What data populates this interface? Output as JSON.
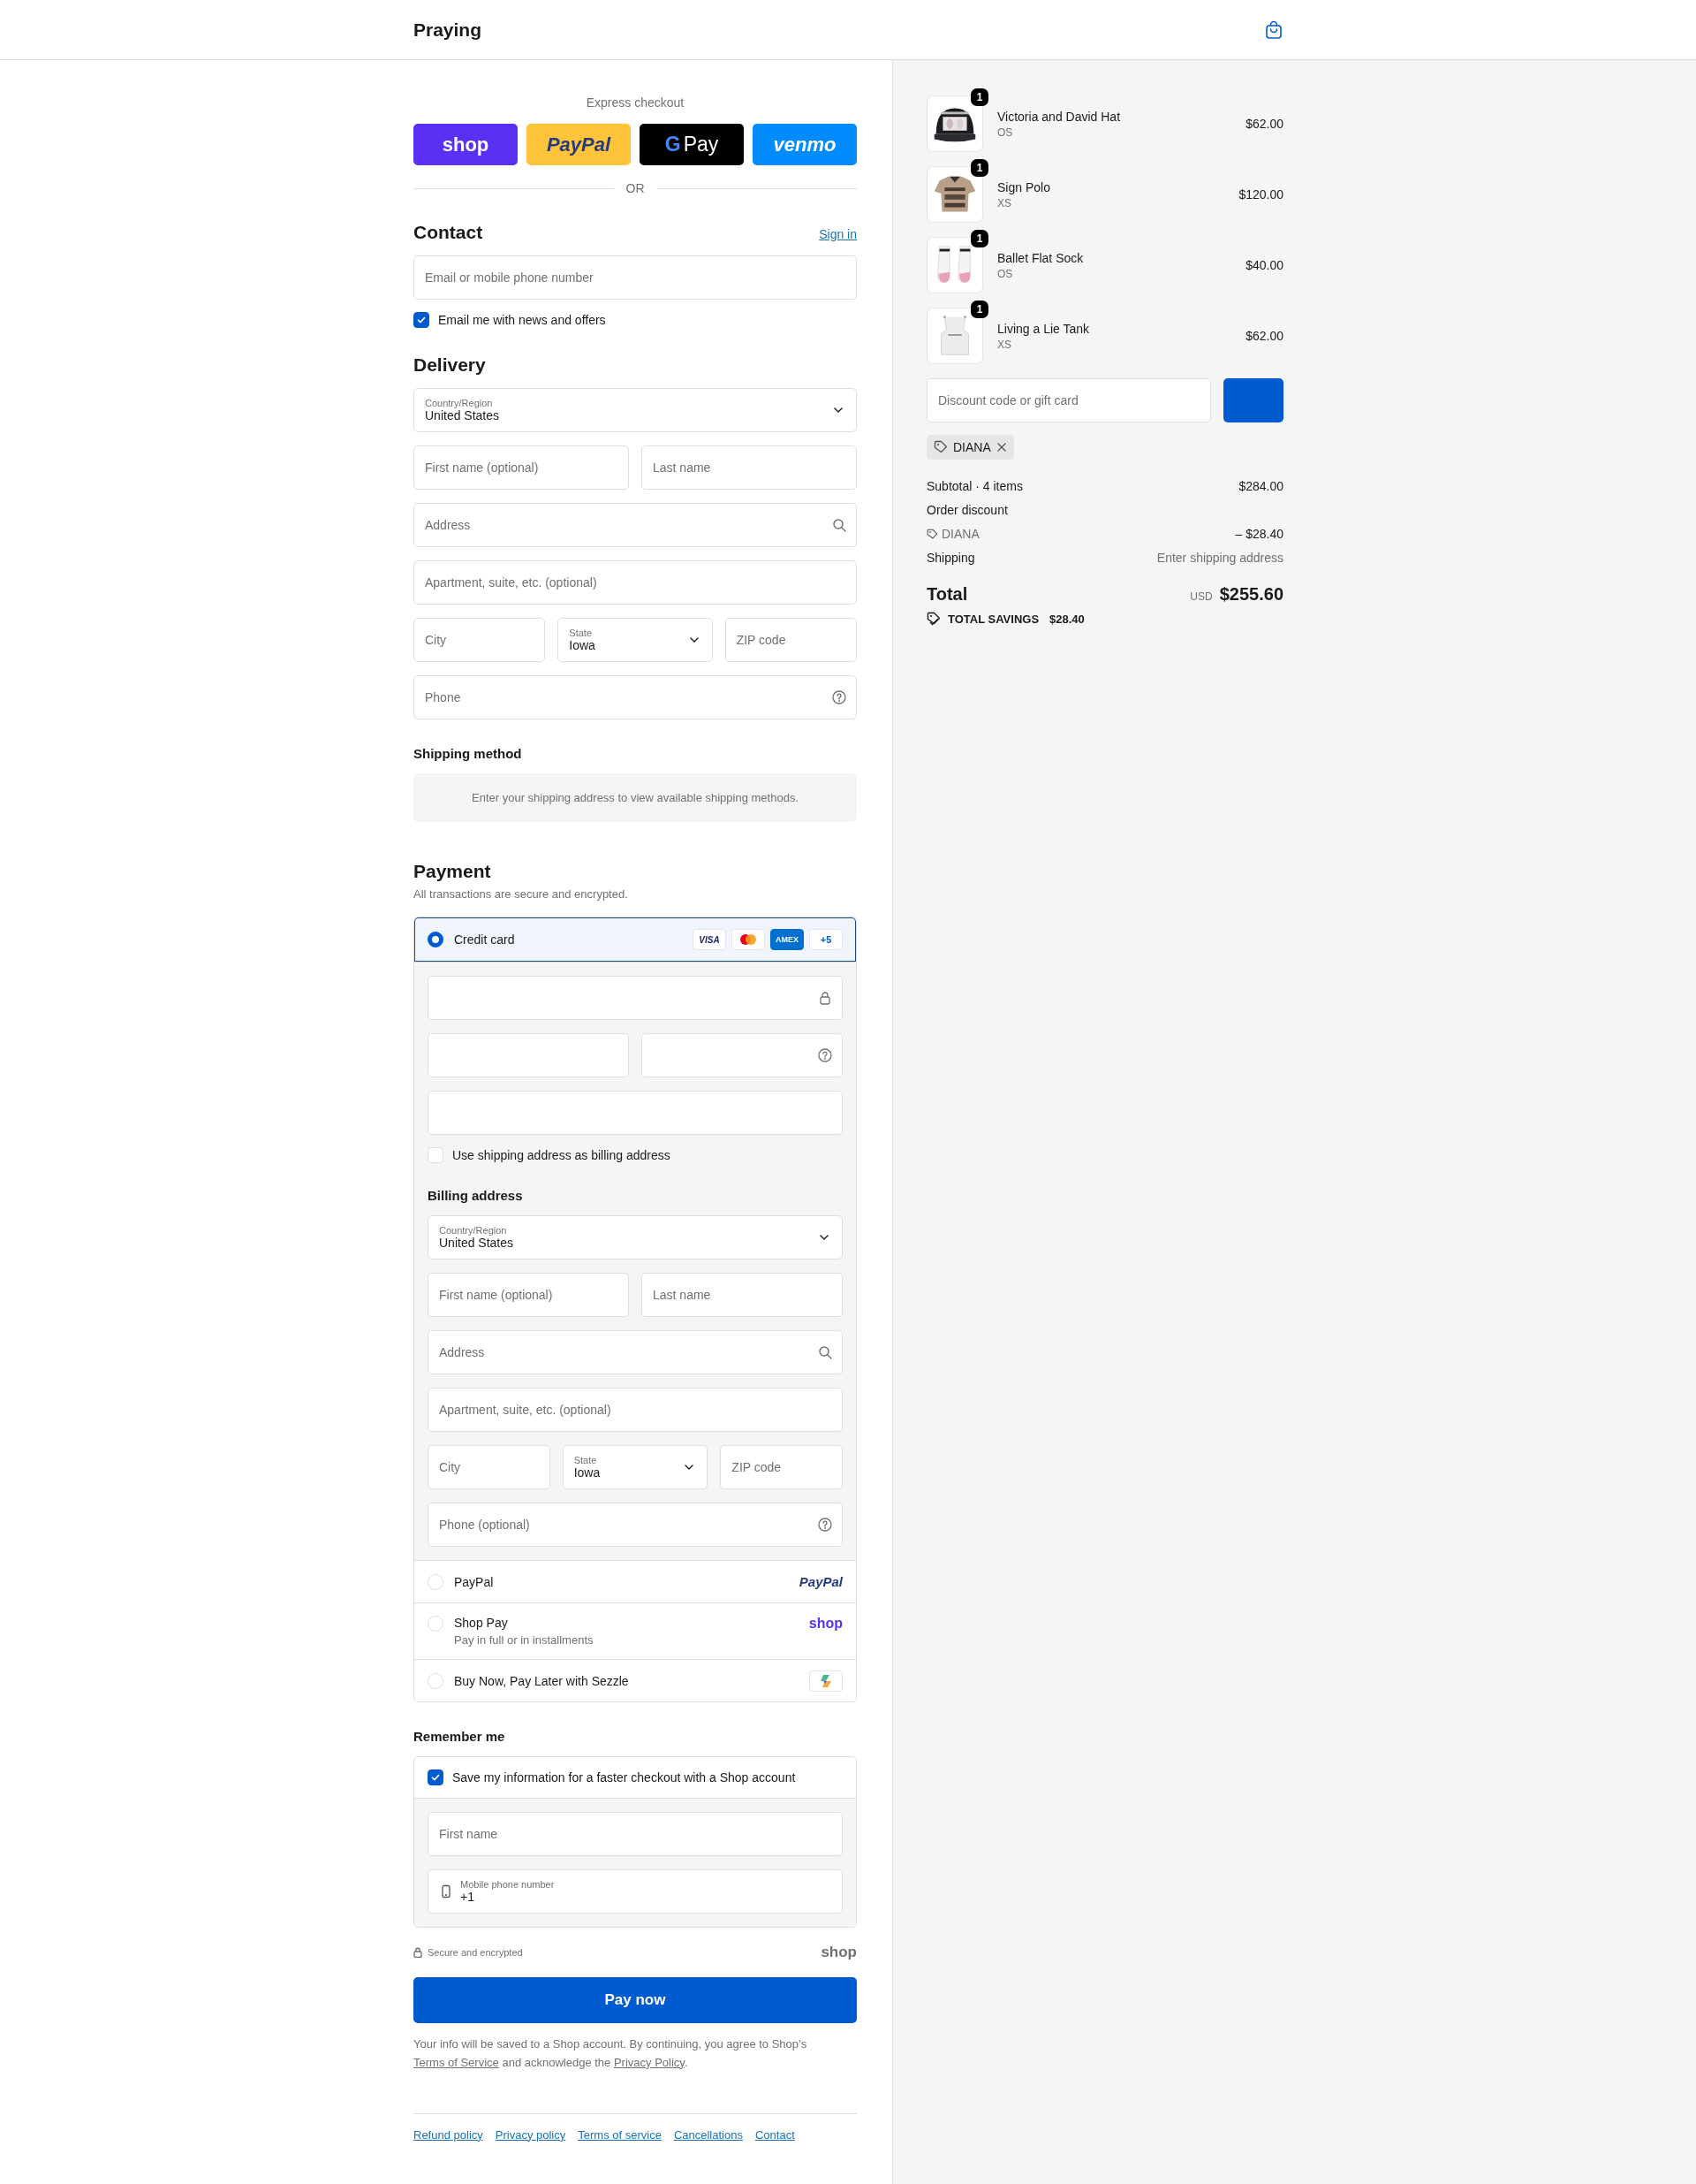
{
  "header": {
    "store_name": "Praying"
  },
  "express_checkout": {
    "title": "Express checkout",
    "buttons": [
      {
        "kind": "shop",
        "label": "shop"
      },
      {
        "kind": "paypal",
        "label": "PayPal"
      },
      {
        "kind": "gpay",
        "logo_letter": "G",
        "label": "Pay"
      },
      {
        "kind": "venmo",
        "label": "venmo"
      }
    ],
    "divider": "OR"
  },
  "contact": {
    "title": "Contact",
    "sign_in": "Sign in",
    "fields": [
      [
        {
          "kind": "text",
          "placeholder": "Email or mobile phone number"
        }
      ]
    ],
    "newsletter": {
      "label": "Email me with news and offers",
      "checked": true
    }
  },
  "delivery": {
    "title": "Delivery",
    "fields": [
      [
        {
          "kind": "select",
          "label": "Country/Region",
          "value": "United States"
        }
      ],
      [
        {
          "kind": "text",
          "placeholder": "First name (optional)"
        },
        {
          "kind": "text",
          "placeholder": "Last name"
        }
      ],
      [
        {
          "kind": "search",
          "placeholder": "Address"
        }
      ],
      [
        {
          "kind": "text",
          "placeholder": "Apartment, suite, etc. (optional)"
        }
      ],
      [
        {
          "kind": "text",
          "placeholder": "City"
        },
        {
          "kind": "select",
          "label": "State",
          "value": "Iowa"
        },
        {
          "kind": "text",
          "placeholder": "ZIP code"
        }
      ],
      [
        {
          "kind": "help",
          "placeholder": "Phone"
        }
      ]
    ]
  },
  "shipping_method": {
    "title": "Shipping method",
    "notice": "Enter your shipping address to view available shipping methods."
  },
  "payment": {
    "title": "Payment",
    "subtitle": "All transactions are secure and encrypted.",
    "methods": [
      {
        "kind": "card",
        "label": "Credit card",
        "selected": true,
        "badges": [
          {
            "kind": "visa",
            "text": "VISA"
          },
          {
            "kind": "mastercard"
          },
          {
            "kind": "amex",
            "text": "AMEX"
          },
          {
            "kind": "more",
            "text": "+5"
          }
        ],
        "details": {
          "card_fields": [
            [
              {
                "kind": "lock"
              }
            ],
            [
              {
                "kind": "text"
              },
              {
                "kind": "help"
              }
            ],
            [
              {
                "kind": "text"
              }
            ]
          ],
          "billing_same": {
            "label": "Use shipping address as billing address",
            "checked": false
          },
          "billing_title": "Billing address",
          "billing_fields": [
            [
              {
                "kind": "select",
                "label": "Country/Region",
                "value": "United States"
              }
            ],
            [
              {
                "kind": "text",
                "placeholder": "First name (optional)"
              },
              {
                "kind": "text",
                "placeholder": "Last name"
              }
            ],
            [
              {
                "kind": "search",
                "placeholder": "Address"
              }
            ],
            [
              {
                "kind": "text",
                "placeholder": "Apartment, suite, etc. (optional)"
              }
            ],
            [
              {
                "kind": "text",
                "placeholder": "City"
              },
              {
                "kind": "select",
                "label": "State",
                "value": "Iowa"
              },
              {
                "kind": "text",
                "placeholder": "ZIP code"
              }
            ],
            [
              {
                "kind": "help",
                "placeholder": "Phone (optional)"
              }
            ]
          ]
        }
      },
      {
        "kind": "paypal",
        "label": "PayPal",
        "selected": false,
        "logo": "PayPal"
      },
      {
        "kind": "shop",
        "label": "Shop Pay",
        "sublabel": "Pay in full or in installments",
        "selected": false,
        "logo": "shop"
      },
      {
        "kind": "sezzle",
        "label": "Buy Now, Pay Later with Sezzle",
        "selected": false
      }
    ]
  },
  "remember_me": {
    "title": "Remember me",
    "save": {
      "label": "Save my information for a faster checkout with a Shop account",
      "checked": true
    },
    "fields": [
      [
        {
          "kind": "text",
          "placeholder": "First name"
        }
      ],
      [
        {
          "kind": "phone",
          "label": "Mobile phone number",
          "value": "+1"
        }
      ]
    ]
  },
  "secure": {
    "text": "Secure and encrypted",
    "logo": "shop"
  },
  "pay_button": "Pay now",
  "legal": [
    {
      "kind": "text",
      "text": "Your info will be saved to a Shop account. By continuing, you agree to Shop’s "
    },
    {
      "kind": "link",
      "text": "Terms of Service"
    },
    {
      "kind": "text",
      "text": " and acknowledge the "
    },
    {
      "kind": "link",
      "text": "Privacy Policy"
    },
    {
      "kind": "text",
      "text": "."
    }
  ],
  "footer_links": [
    "Refund policy",
    "Privacy policy",
    "Terms of service",
    "Cancellations",
    "Contact"
  ],
  "summary": {
    "items": [
      {
        "name": "Victoria and David Hat",
        "variant": "OS",
        "price": "$62.00",
        "quantity": "1"
      },
      {
        "name": "Sign Polo",
        "variant": "XS",
        "price": "$120.00",
        "quantity": "1"
      },
      {
        "name": "Ballet Flat Sock",
        "variant": "OS",
        "price": "$40.00",
        "quantity": "1"
      },
      {
        "name": "Living a Lie Tank",
        "variant": "XS",
        "price": "$62.00",
        "quantity": "1"
      }
    ],
    "discount": {
      "placeholder": "Discount code or gift card"
    },
    "applied_codes": [
      {
        "code": "DIANA"
      }
    ],
    "lines": [
      {
        "kind": "amount",
        "label": "Subtotal · 4 items",
        "value": "$284.00"
      },
      {
        "kind": "heading",
        "label": "Order discount"
      },
      {
        "kind": "code",
        "label": "DIANA",
        "value": "– $28.40"
      },
      {
        "kind": "note",
        "label": "Shipping",
        "value": "Enter shipping address"
      }
    ],
    "total": {
      "label": "Total",
      "currency": "USD",
      "value": "$255.60"
    },
    "savings": {
      "label": "TOTAL SAVINGS",
      "value": "$28.40"
    }
  }
}
